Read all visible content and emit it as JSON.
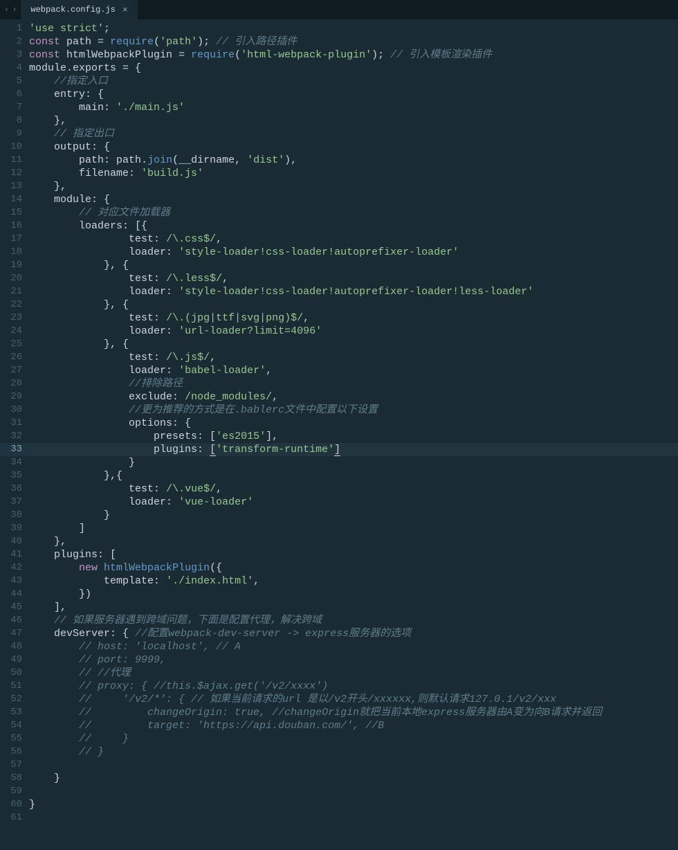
{
  "tab": {
    "filename": "webpack.config.js"
  },
  "nav": {
    "left": "‹",
    "right": "›"
  },
  "currentLine": 33,
  "code": [
    [
      [
        "str",
        "'use strict'"
      ],
      [
        "pun",
        ";"
      ]
    ],
    [
      [
        "kw",
        "const"
      ],
      [
        "pun",
        " "
      ],
      [
        "var",
        "path"
      ],
      [
        "pun",
        " = "
      ],
      [
        "fn",
        "require"
      ],
      [
        "pun",
        "("
      ],
      [
        "str",
        "'path'"
      ],
      [
        "pun",
        "); "
      ],
      [
        "cmt",
        "// 引入路径插件"
      ]
    ],
    [
      [
        "kw",
        "const"
      ],
      [
        "pun",
        " "
      ],
      [
        "var",
        "htmlWebpackPlugin"
      ],
      [
        "pun",
        " = "
      ],
      [
        "fn",
        "require"
      ],
      [
        "pun",
        "("
      ],
      [
        "str",
        "'html-webpack-plugin'"
      ],
      [
        "pun",
        "); "
      ],
      [
        "cmt",
        "// 引入模板渲染插件"
      ]
    ],
    [
      [
        "var",
        "module"
      ],
      [
        "pun",
        "."
      ],
      [
        "var",
        "exports"
      ],
      [
        "pun",
        " = {"
      ]
    ],
    [
      [
        "pun",
        "    "
      ],
      [
        "cmt",
        "//指定入口"
      ]
    ],
    [
      [
        "pun",
        "    "
      ],
      [
        "prop",
        "entry"
      ],
      [
        "pun",
        ": {"
      ]
    ],
    [
      [
        "pun",
        "        "
      ],
      [
        "prop",
        "main"
      ],
      [
        "pun",
        ": "
      ],
      [
        "str",
        "'./main.js'"
      ]
    ],
    [
      [
        "pun",
        "    },"
      ]
    ],
    [
      [
        "pun",
        "    "
      ],
      [
        "cmt",
        "// 指定出口"
      ]
    ],
    [
      [
        "pun",
        "    "
      ],
      [
        "prop",
        "output"
      ],
      [
        "pun",
        ": {"
      ]
    ],
    [
      [
        "pun",
        "        "
      ],
      [
        "prop",
        "path"
      ],
      [
        "pun",
        ": "
      ],
      [
        "var",
        "path"
      ],
      [
        "pun",
        "."
      ],
      [
        "fn",
        "join"
      ],
      [
        "pun",
        "("
      ],
      [
        "var",
        "__dirname"
      ],
      [
        "pun",
        ", "
      ],
      [
        "str",
        "'dist'"
      ],
      [
        "pun",
        "),"
      ]
    ],
    [
      [
        "pun",
        "        "
      ],
      [
        "prop",
        "filename"
      ],
      [
        "pun",
        ": "
      ],
      [
        "str",
        "'build.js'"
      ]
    ],
    [
      [
        "pun",
        "    },"
      ]
    ],
    [
      [
        "pun",
        "    "
      ],
      [
        "prop",
        "module"
      ],
      [
        "pun",
        ": {"
      ]
    ],
    [
      [
        "pun",
        "        "
      ],
      [
        "cmt",
        "// 对应文件加载器"
      ]
    ],
    [
      [
        "pun",
        "        "
      ],
      [
        "prop",
        "loaders"
      ],
      [
        "pun",
        ": [{"
      ]
    ],
    [
      [
        "pun",
        "                "
      ],
      [
        "prop",
        "test"
      ],
      [
        "pun",
        ": "
      ],
      [
        "reg",
        "/\\.css$/"
      ],
      [
        "pun",
        ","
      ]
    ],
    [
      [
        "pun",
        "                "
      ],
      [
        "prop",
        "loader"
      ],
      [
        "pun",
        ": "
      ],
      [
        "str",
        "'style-loader!css-loader!autoprefixer-loader'"
      ]
    ],
    [
      [
        "pun",
        "            }, {"
      ]
    ],
    [
      [
        "pun",
        "                "
      ],
      [
        "prop",
        "test"
      ],
      [
        "pun",
        ": "
      ],
      [
        "reg",
        "/\\.less$/"
      ],
      [
        "pun",
        ","
      ]
    ],
    [
      [
        "pun",
        "                "
      ],
      [
        "prop",
        "loader"
      ],
      [
        "pun",
        ": "
      ],
      [
        "str",
        "'style-loader!css-loader!autoprefixer-loader!less-loader'"
      ]
    ],
    [
      [
        "pun",
        "            }, {"
      ]
    ],
    [
      [
        "pun",
        "                "
      ],
      [
        "prop",
        "test"
      ],
      [
        "pun",
        ": "
      ],
      [
        "reg",
        "/\\.(jpg|ttf|svg|png)$/"
      ],
      [
        "pun",
        ","
      ]
    ],
    [
      [
        "pun",
        "                "
      ],
      [
        "prop",
        "loader"
      ],
      [
        "pun",
        ": "
      ],
      [
        "str",
        "'url-loader?limit=4096'"
      ]
    ],
    [
      [
        "pun",
        "            }, {"
      ]
    ],
    [
      [
        "pun",
        "                "
      ],
      [
        "prop",
        "test"
      ],
      [
        "pun",
        ": "
      ],
      [
        "reg",
        "/\\.js$/"
      ],
      [
        "pun",
        ","
      ]
    ],
    [
      [
        "pun",
        "                "
      ],
      [
        "prop",
        "loader"
      ],
      [
        "pun",
        ": "
      ],
      [
        "str",
        "'babel-loader'"
      ],
      [
        "pun",
        ","
      ]
    ],
    [
      [
        "pun",
        "                "
      ],
      [
        "cmt",
        "//排除路径"
      ]
    ],
    [
      [
        "pun",
        "                "
      ],
      [
        "prop",
        "exclude"
      ],
      [
        "pun",
        ": "
      ],
      [
        "reg",
        "/node_modules/"
      ],
      [
        "pun",
        ","
      ]
    ],
    [
      [
        "pun",
        "                "
      ],
      [
        "cmt",
        "//更为推荐的方式是在.bablerc文件中配置以下设置"
      ]
    ],
    [
      [
        "pun",
        "                "
      ],
      [
        "prop",
        "options"
      ],
      [
        "pun",
        ": {"
      ]
    ],
    [
      [
        "pun",
        "                    "
      ],
      [
        "prop",
        "presets"
      ],
      [
        "pun",
        ": ["
      ],
      [
        "str",
        "'es2015'"
      ],
      [
        "pun",
        "],"
      ]
    ],
    [
      [
        "pun",
        "                    "
      ],
      [
        "prop",
        "plugins"
      ],
      [
        "pun",
        ": "
      ],
      [
        "cur",
        "["
      ],
      [
        "str",
        "'transform-runtime'"
      ],
      [
        "cur",
        "]"
      ]
    ],
    [
      [
        "pun",
        "                }"
      ]
    ],
    [
      [
        "pun",
        "            },{"
      ]
    ],
    [
      [
        "pun",
        "                "
      ],
      [
        "prop",
        "test"
      ],
      [
        "pun",
        ": "
      ],
      [
        "reg",
        "/\\.vue$/"
      ],
      [
        "pun",
        ","
      ]
    ],
    [
      [
        "pun",
        "                "
      ],
      [
        "prop",
        "loader"
      ],
      [
        "pun",
        ": "
      ],
      [
        "str",
        "'vue-loader'"
      ]
    ],
    [
      [
        "pun",
        "            }"
      ]
    ],
    [
      [
        "pun",
        "        ]"
      ]
    ],
    [
      [
        "pun",
        "    },"
      ]
    ],
    [
      [
        "pun",
        "    "
      ],
      [
        "prop",
        "plugins"
      ],
      [
        "pun",
        ": ["
      ]
    ],
    [
      [
        "pun",
        "        "
      ],
      [
        "kw",
        "new"
      ],
      [
        "pun",
        " "
      ],
      [
        "fn",
        "htmlWebpackPlugin"
      ],
      [
        "pun",
        "({"
      ]
    ],
    [
      [
        "pun",
        "            "
      ],
      [
        "prop",
        "template"
      ],
      [
        "pun",
        ": "
      ],
      [
        "str",
        "'./index.html'"
      ],
      [
        "pun",
        ","
      ]
    ],
    [
      [
        "pun",
        "        })"
      ]
    ],
    [
      [
        "pun",
        "    ],"
      ]
    ],
    [
      [
        "pun",
        "    "
      ],
      [
        "cmt",
        "// 如果服务器遇到跨域问题，下面是配置代理，解决跨域"
      ]
    ],
    [
      [
        "pun",
        "    "
      ],
      [
        "prop",
        "devServer"
      ],
      [
        "pun",
        ": { "
      ],
      [
        "cmt",
        "//配置webpack-dev-server -> express服务器的选项"
      ]
    ],
    [
      [
        "pun",
        "        "
      ],
      [
        "cmt",
        "// host: 'localhost', // A"
      ]
    ],
    [
      [
        "pun",
        "        "
      ],
      [
        "cmt",
        "// port: 9999,"
      ]
    ],
    [
      [
        "pun",
        "        "
      ],
      [
        "cmt",
        "// //代理"
      ]
    ],
    [
      [
        "pun",
        "        "
      ],
      [
        "cmt",
        "// proxy: { //this.$ajax.get('/v2/xxxx')"
      ]
    ],
    [
      [
        "pun",
        "        "
      ],
      [
        "cmt",
        "//     '/v2/*': { // 如果当前请求的url 是以/v2开头/xxxxxx,则默认请求127.0.1/v2/xxx"
      ]
    ],
    [
      [
        "pun",
        "        "
      ],
      [
        "cmt",
        "//         changeOrigin: true, //changeOrigin就把当前本地express服务器由A变为向B请求并返回"
      ]
    ],
    [
      [
        "pun",
        "        "
      ],
      [
        "cmt",
        "//         target: 'https://api.douban.com/', //B"
      ]
    ],
    [
      [
        "pun",
        "        "
      ],
      [
        "cmt",
        "//     }"
      ]
    ],
    [
      [
        "pun",
        "        "
      ],
      [
        "cmt",
        "// }"
      ]
    ],
    [
      [
        "pun",
        ""
      ]
    ],
    [
      [
        "pun",
        "    }"
      ]
    ],
    [
      [
        "pun",
        ""
      ]
    ],
    [
      [
        "pun",
        "}"
      ]
    ],
    [
      [
        "pun",
        ""
      ]
    ]
  ]
}
